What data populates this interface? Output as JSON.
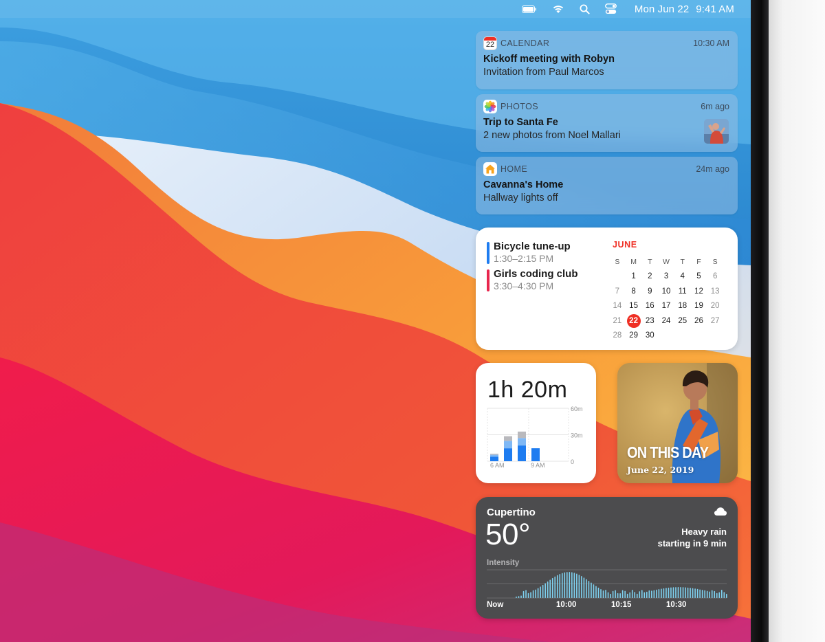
{
  "menubar": {
    "icons": [
      "battery-icon",
      "wifi-icon",
      "search-icon",
      "control-center-icon"
    ],
    "date": "Mon Jun 22",
    "time": "9:41 AM"
  },
  "notifications": [
    {
      "app": "CALENDAR",
      "app_icon": "calendar-app-icon",
      "icon_text": "22",
      "time": "10:30 AM",
      "title": "Kickoff meeting with Robyn",
      "body": "Invitation from Paul Marcos"
    },
    {
      "app": "PHOTOS",
      "app_icon": "photos-app-icon",
      "time": "6m ago",
      "title": "Trip to Santa Fe",
      "body": "2 new photos from Noel Mallari",
      "has_thumbnail": true
    },
    {
      "app": "HOME",
      "app_icon": "home-app-icon",
      "time": "24m ago",
      "title": "Cavanna's Home",
      "body": "Hallway lights off"
    }
  ],
  "calendar_widget": {
    "events": [
      {
        "title": "Bicycle tune-up",
        "time": "1:30–2:15 PM",
        "color": "#1e7cf0"
      },
      {
        "title": "Girls coding club",
        "time": "3:30–4:30 PM",
        "color": "#e8264d"
      }
    ],
    "month": "JUNE",
    "weekday_headers": [
      "S",
      "M",
      "T",
      "W",
      "T",
      "F",
      "S"
    ],
    "weeks": [
      [
        "",
        "1",
        "2",
        "3",
        "4",
        "5",
        "6"
      ],
      [
        "7",
        "8",
        "9",
        "10",
        "11",
        "12",
        "13"
      ],
      [
        "14",
        "15",
        "16",
        "17",
        "18",
        "19",
        "20"
      ],
      [
        "21",
        "22",
        "23",
        "24",
        "25",
        "26",
        "27"
      ],
      [
        "28",
        "29",
        "30",
        "",
        "",
        "",
        ""
      ]
    ],
    "today": "22",
    "accent": "#ef2f24"
  },
  "screen_time_widget": {
    "total": "1h 20m",
    "y_labels": [
      "60m",
      "30m",
      "0"
    ],
    "x_labels": [
      "6 AM",
      "9 AM"
    ],
    "colors": {
      "primary": "#1e7cf0",
      "secondary": "#7fb8f5",
      "other": "#b9b9bd"
    }
  },
  "photo_widget": {
    "title": "ON THIS DAY",
    "date": "June 22, 2019"
  },
  "weather_widget": {
    "city": "Cupertino",
    "temperature": "50°",
    "condition_line1": "Heavy rain",
    "condition_line2": "starting in 9 min",
    "icon": "cloud-icon",
    "intensity_label": "Intensity",
    "x_labels": [
      "Now",
      "10:00",
      "10:15",
      "10:30"
    ],
    "bar_color": "#7fd3f2"
  }
}
